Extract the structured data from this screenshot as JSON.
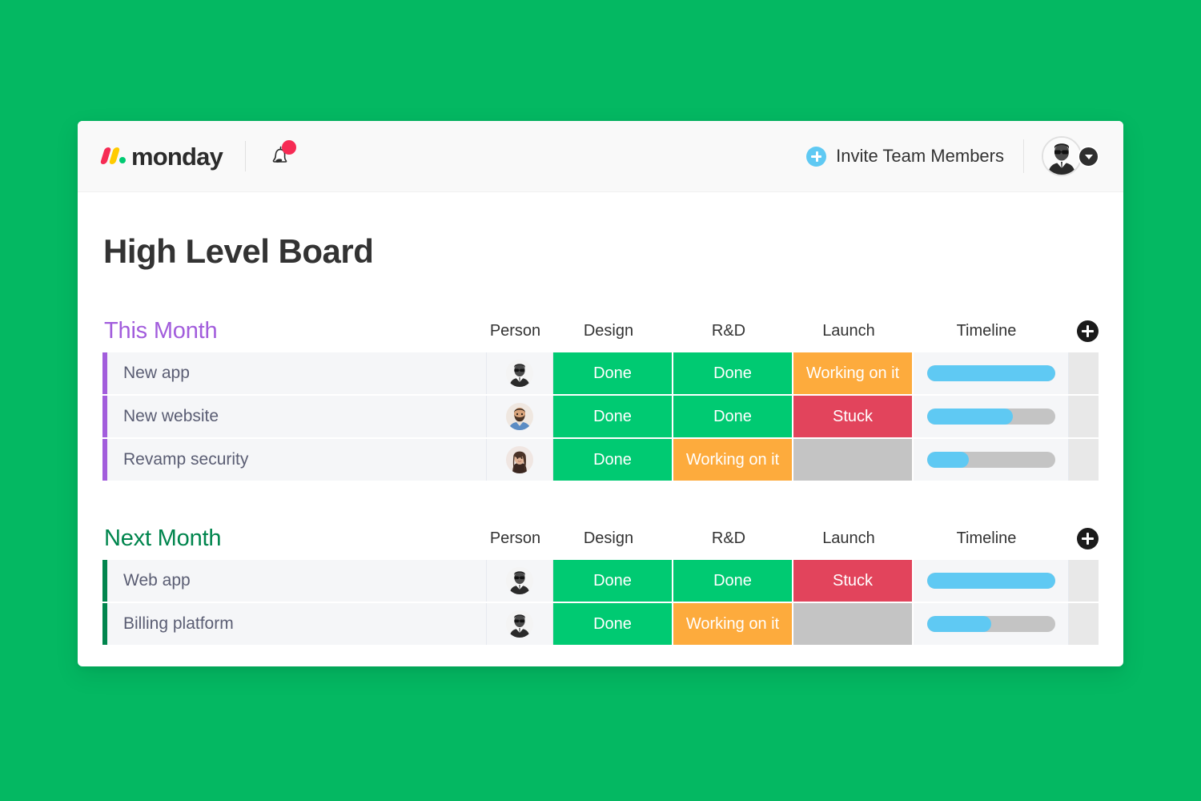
{
  "window": {
    "background_color": "#04b862",
    "card_background": "#ffffff"
  },
  "topbar": {
    "logo_word": "monday",
    "logo_icon": "monday-logo",
    "logo_colors": {
      "slash1": "#f62b54",
      "slash2": "#ffcb00",
      "dot": "#00ca72"
    },
    "notifications_icon": "bell-icon",
    "notifications_badge_color": "#f62b54",
    "invite_label": "Invite Team Members",
    "invite_icon": "plus-circle-icon",
    "invite_icon_color": "#5fc9f3",
    "user_avatar_icon": "user-avatar",
    "user_menu_icon": "chevron-down-icon"
  },
  "board": {
    "title": "High Level Board",
    "add_column_icon": "plus-circle-icon",
    "columns": [
      "Person",
      "Design",
      "R&D",
      "Launch",
      "Timeline"
    ],
    "status_colors": {
      "Done": "#00ca72",
      "Working on it": "#fdab3d",
      "Stuck": "#e2445c",
      "empty": "#c4c4c4"
    },
    "timeline_bar_color": "#5fc9f3",
    "timeline_track_color": "#c4c4c4",
    "groups": [
      {
        "name": "This Month",
        "color": "#a25ddc",
        "columns": [
          "Person",
          "Design",
          "R&D",
          "Launch",
          "Timeline"
        ],
        "add_column_label": "+",
        "rows": [
          {
            "name": "New app",
            "person": "avatar-man-sunglasses",
            "design": "Done",
            "rd": "Done",
            "launch": "Working on it",
            "timeline_percent": 100
          },
          {
            "name": "New website",
            "person": "avatar-bearded-man",
            "design": "Done",
            "rd": "Done",
            "launch": "Stuck",
            "timeline_percent": 67
          },
          {
            "name": "Revamp security",
            "person": "avatar-woman",
            "design": "Done",
            "rd": "Working on it",
            "launch": "",
            "timeline_percent": 33
          }
        ]
      },
      {
        "name": "Next Month",
        "color": "#00854d",
        "columns": [
          "Person",
          "Design",
          "R&D",
          "Launch",
          "Timeline"
        ],
        "add_column_label": "+",
        "rows": [
          {
            "name": "Web app",
            "person": "avatar-man-sunglasses",
            "design": "Done",
            "rd": "Done",
            "launch": "Stuck",
            "timeline_percent": 100
          },
          {
            "name": "Billing platform",
            "person": "avatar-man-sunglasses",
            "design": "Done",
            "rd": "Working on it",
            "launch": "",
            "timeline_percent": 50
          }
        ]
      }
    ]
  }
}
